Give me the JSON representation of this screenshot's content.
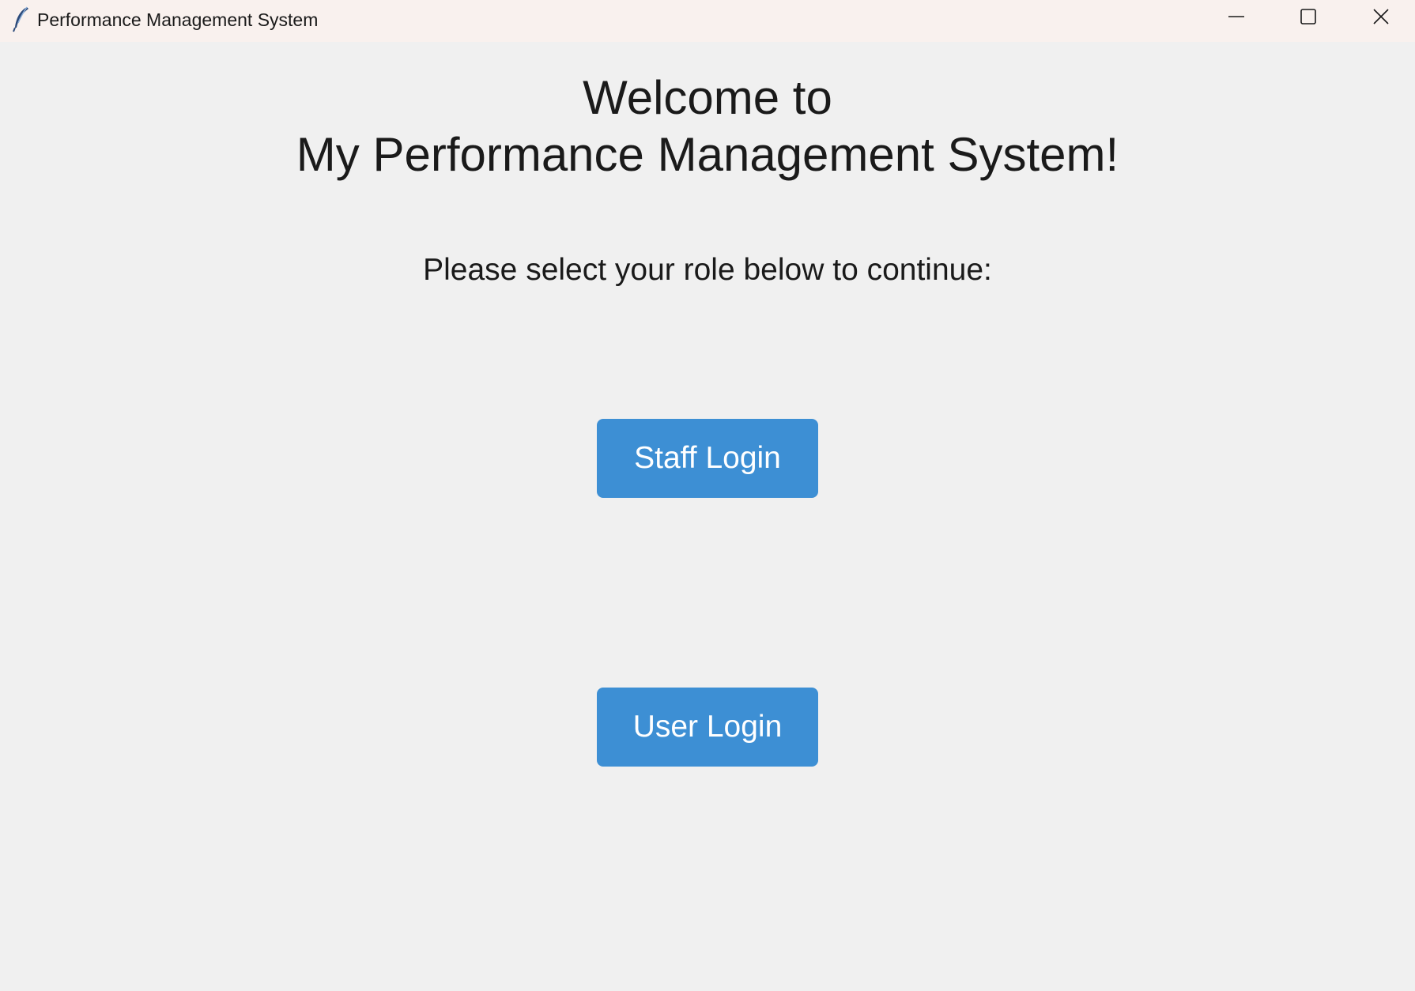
{
  "window": {
    "title": "Performance Management System",
    "icon": "feather-icon",
    "controls": {
      "minimize": "minimize-icon",
      "maximize": "maximize-icon",
      "close": "close-icon"
    }
  },
  "main": {
    "welcome_line1": "Welcome to",
    "welcome_line2": "My Performance Management System!",
    "prompt": "Please select your role below to continue:",
    "buttons": {
      "staff_login": "Staff Login",
      "user_login": "User Login"
    }
  },
  "colors": {
    "background": "#f0f0f0",
    "titlebar": "#f9f1ee",
    "button": "#3d8fd4",
    "button_text": "#ffffff",
    "text": "#1a1a1a"
  }
}
